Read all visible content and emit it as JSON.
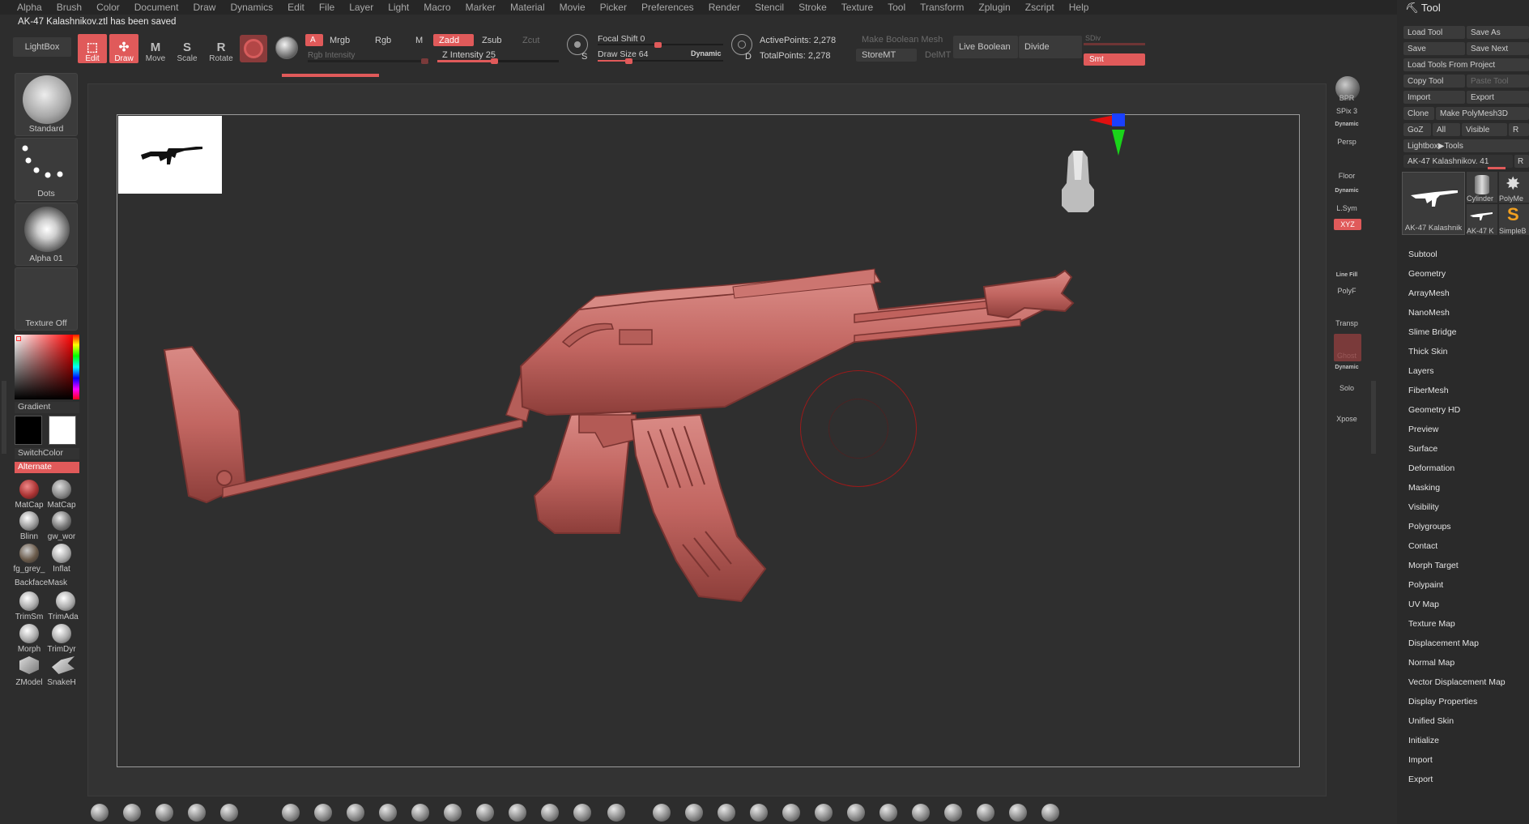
{
  "menu": [
    "Alpha",
    "Brush",
    "Color",
    "Document",
    "Draw",
    "Dynamics",
    "Edit",
    "File",
    "Layer",
    "Light",
    "Macro",
    "Marker",
    "Material",
    "Movie",
    "Picker",
    "Preferences",
    "Render",
    "Stencil",
    "Stroke",
    "Texture",
    "Tool",
    "Transform",
    "Zplugin",
    "Zscript",
    "Help"
  ],
  "notice": "AK-47 Kalashnikov.ztl has been saved",
  "toolbar": {
    "lightbox": "LightBox",
    "edit": "Edit",
    "draw": "Draw",
    "move": "Move",
    "scale": "Scale",
    "rotate": "Rotate",
    "a": "A",
    "mrgb": "Mrgb",
    "rgb": "Rgb",
    "m": "M",
    "rgb_intensity": "Rgb Intensity",
    "zadd": "Zadd",
    "zsub": "Zsub",
    "zcut": "Zcut",
    "z_intensity": "Z Intensity 25",
    "focal_shift": "Focal Shift 0",
    "draw_size": "Draw Size 64",
    "dynamic": "Dynamic",
    "s_label": "S",
    "d_label": "D",
    "active_points": "ActivePoints: 2,278",
    "total_points": "TotalPoints: 2,278",
    "make_boolean": "Make Boolean Mesh",
    "store_mt": "StoreMT",
    "del_mt": "DelMT",
    "live_boolean": "Live Boolean",
    "divide": "Divide",
    "sdiv": "SDiv",
    "smt": "Smt"
  },
  "left": {
    "brush": "Standard",
    "stroke": "Dots",
    "alpha": "Alpha 01",
    "texture": "Texture Off",
    "gradient": "Gradient",
    "switchcolor": "SwitchColor",
    "alternate": "Alternate",
    "materials": [
      "MatCap",
      "MatCap",
      "Blinn",
      "gw_wor",
      "fg_grey_",
      "Inflat"
    ],
    "backface": "BackfaceMask",
    "materials2": [
      "TrimSm",
      "TrimAda",
      "Morph",
      "TrimDyr",
      "ZModel",
      "SnakeH"
    ]
  },
  "rightstrip": {
    "bpr": "BPR",
    "spix": "SPix 3",
    "dynamic": "Dynamic",
    "persp": "Persp",
    "floor": "Floor",
    "dynamic2": "Dynamic",
    "lsym": "L.Sym",
    "xyz": "XYZ",
    "polyf": "PolyF",
    "transp": "Transp",
    "ghost": "Ghost",
    "dynamic3": "Dynamic",
    "solo": "Solo",
    "xpose": "Xpose",
    "line_fill": "Line Fill"
  },
  "tool": {
    "title": "Tool",
    "load_tool": "Load Tool",
    "save_as": "Save As",
    "save": "Save",
    "save_next": "Save Next",
    "load_from_project": "Load Tools From Project",
    "copy_tool": "Copy Tool",
    "paste_tool": "Paste Tool",
    "import": "Import",
    "export": "Export",
    "clone": "Clone",
    "make_polymesh": "Make PolyMesh3D",
    "goz": "GoZ",
    "all": "All",
    "visible": "Visible",
    "r": "R",
    "lightbox_tools": "Lightbox▶Tools",
    "current_tool": "AK-47 Kalashnikov. 41",
    "r2": "R",
    "thumbs": [
      "AK-47 Kalashnik",
      "Cylinder",
      "PolyMe",
      "AK-47 K",
      "SimpleB"
    ],
    "sections": [
      "Subtool",
      "Geometry",
      "ArrayMesh",
      "NanoMesh",
      "Slime Bridge",
      "Thick Skin",
      "Layers",
      "FiberMesh",
      "Geometry HD",
      "Preview",
      "Surface",
      "Deformation",
      "Masking",
      "Visibility",
      "Polygroups",
      "Contact",
      "Morph Target",
      "Polypaint",
      "UV Map",
      "Texture Map",
      "Displacement Map",
      "Normal Map",
      "Vector Displacement Map",
      "Display Properties",
      "Unified Skin",
      "Initialize",
      "Import",
      "Export"
    ]
  },
  "colors": {
    "accent": "#e05a5a",
    "model": "#c86a66",
    "bg": "#2d2d2d"
  }
}
